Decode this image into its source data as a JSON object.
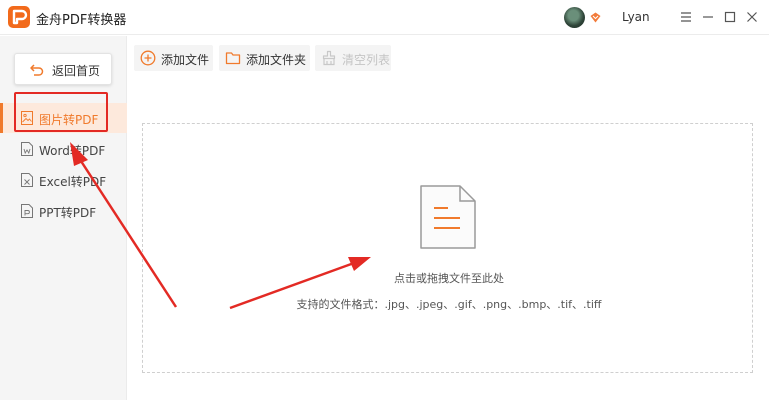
{
  "app": {
    "title": "金舟PDF转换器"
  },
  "user": {
    "name": "Lyan"
  },
  "window_controls": {
    "menu": "menu-icon",
    "minimize": "minimize-icon",
    "maximize": "maximize-icon",
    "close": "close-icon"
  },
  "sidebar": {
    "back_label": "返回首页",
    "items": [
      {
        "label": "图片转PDF",
        "icon": "image-file-icon",
        "active": true
      },
      {
        "label": "Word转PDF",
        "icon": "word-file-icon",
        "active": false
      },
      {
        "label": "Excel转PDF",
        "icon": "excel-file-icon",
        "active": false
      },
      {
        "label": "PPT转PDF",
        "icon": "ppt-file-icon",
        "active": false
      }
    ]
  },
  "toolbar": {
    "add_file": "添加文件",
    "add_folder": "添加文件夹",
    "clear_list": "清空列表"
  },
  "dropzone": {
    "hint": "点击或拖拽文件至此处",
    "formats": "支持的文件格式：.jpg、.jpeg、.gif、.png、.bmp、.tif、.tiff"
  },
  "colors": {
    "accent": "#f07a2c",
    "annotation": "#e32a24",
    "active_bg": "#fde9dc"
  }
}
